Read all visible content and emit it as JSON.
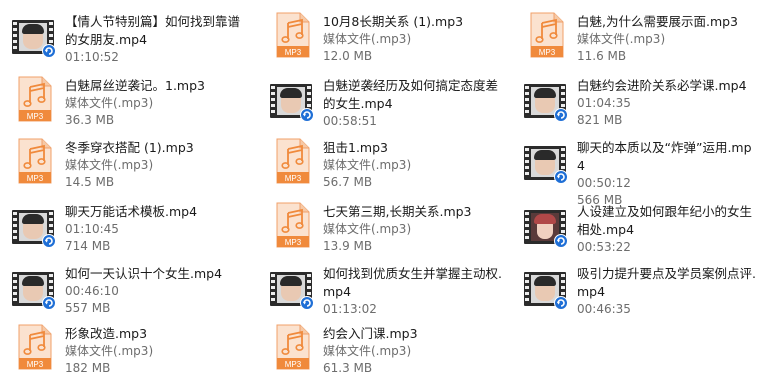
{
  "files": [
    {
      "name": "【情人节特别篇】如何找到靠谱的女朋友.mp4",
      "meta": "01:10:52",
      "type": "video",
      "variant": false
    },
    {
      "name": "10月8长期关系 (1).mp3",
      "type_label": "媒体文件(.mp3)",
      "meta": "12.0 MB",
      "type": "audio"
    },
    {
      "name": "白魅,为什么需要展示面.mp3",
      "type_label": "媒体文件(.mp3)",
      "meta": "11.6 MB",
      "type": "audio"
    },
    {
      "name": "白魅屌丝逆袭记。1.mp3",
      "type_label": "媒体文件(.mp3)",
      "meta": "36.3 MB",
      "type": "audio"
    },
    {
      "name": "白魅逆袭经历及如何搞定态度差的女生.mp4",
      "meta": "00:58:51",
      "type": "video",
      "variant": false
    },
    {
      "name": "白魅约会进阶关系必学课.mp4",
      "meta": "01:04:35",
      "size": "821 MB",
      "type": "video",
      "variant": false
    },
    {
      "name": "冬季穿衣搭配 (1).mp3",
      "type_label": "媒体文件(.mp3)",
      "meta": "14.5 MB",
      "type": "audio"
    },
    {
      "name": "狙击1.mp3",
      "type_label": "媒体文件(.mp3)",
      "meta": "56.7 MB",
      "type": "audio"
    },
    {
      "name": "聊天的本质以及“炸弹”运用.mp4",
      "meta": "00:50:12",
      "size": "566 MB",
      "type": "video",
      "variant": false
    },
    {
      "name": "聊天万能话术模板.mp4",
      "meta": "01:10:45",
      "size": "714 MB",
      "type": "video",
      "variant": false
    },
    {
      "name": "七天第三期,长期关系.mp3",
      "type_label": "媒体文件(.mp3)",
      "meta": "13.9 MB",
      "type": "audio"
    },
    {
      "name": "人设建立及如何跟年纪小的女生相处.mp4",
      "meta": "00:53:22",
      "type": "video",
      "variant": true
    },
    {
      "name": "如何一天认识十个女生.mp4",
      "meta": "00:46:10",
      "size": "557 MB",
      "type": "video",
      "variant": false
    },
    {
      "name": "如何找到优质女生并掌握主动权.mp4",
      "meta": "01:13:02",
      "type": "video",
      "variant": false
    },
    {
      "name": "吸引力提升要点及学员案例点评.mp4",
      "meta": "00:46:35",
      "type": "video",
      "variant": false
    },
    {
      "name": "形象改造.mp3",
      "type_label": "媒体文件(.mp3)",
      "meta": "182 MB",
      "type": "audio"
    },
    {
      "name": "约会入门课.mp3",
      "type_label": "媒体文件(.mp3)",
      "meta": "61.3 MB",
      "type": "audio"
    }
  ],
  "icons": {
    "audio": "mp3-file-icon",
    "video": "video-thumbnail-icon",
    "audio_badge": "MP3",
    "accent_orange": "#f08a3c",
    "badge_blue": "#1f6fd6"
  }
}
